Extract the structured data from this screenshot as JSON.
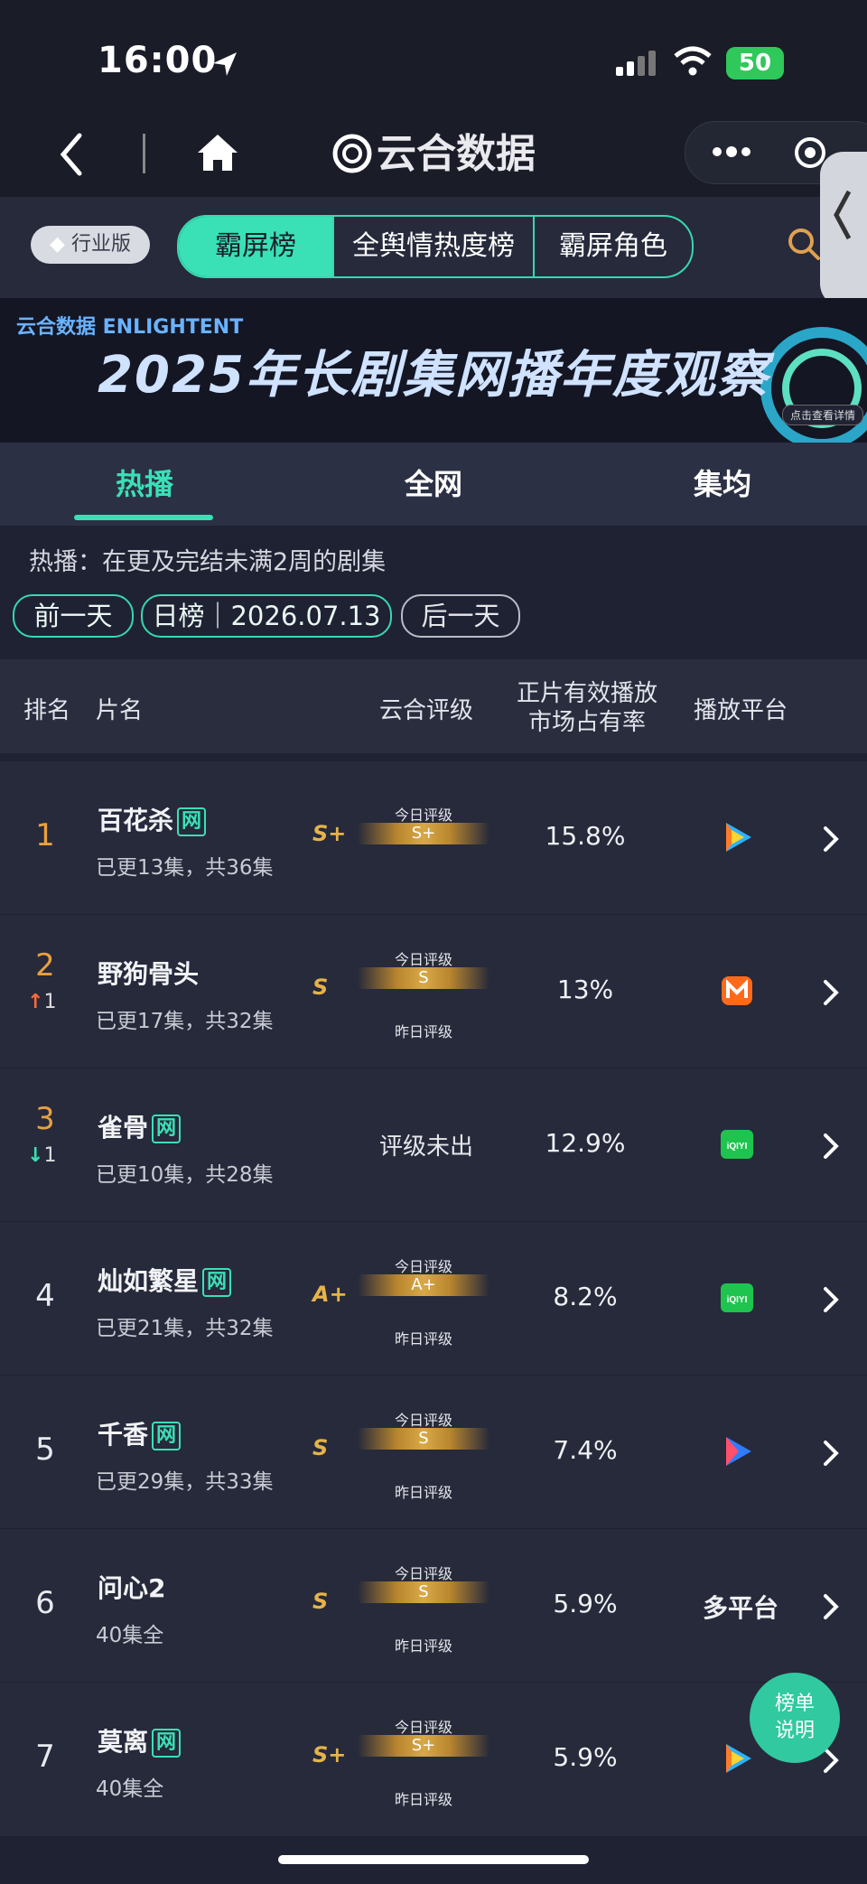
{
  "status": {
    "time": "16:00",
    "battery": "50"
  },
  "nav": {
    "title": "云合数据"
  },
  "tier_badge": "行业版",
  "segments": [
    "霸屏榜",
    "全舆情热度榜",
    "霸屏角色"
  ],
  "banner": {
    "logo": "云合数据 ENLIGHTENT",
    "title": "2025年长剧集网播年度观察",
    "hint": "点击查看详情"
  },
  "tabs": [
    "热播",
    "全网",
    "集均"
  ],
  "description": "热播：在更及完结未满2周的剧集",
  "date_controls": {
    "prev": "前一天",
    "daily": "日榜｜2026.07.13",
    "next": "后一天"
  },
  "table_header": {
    "rank": "排名",
    "name": "片名",
    "rating": "云合评级",
    "share": "正片有效播放\n市场占有率",
    "platform": "播放平台"
  },
  "rows": [
    {
      "rank": "1",
      "change": "",
      "title": "百花杀",
      "badge": "网",
      "episodes": "已更13集，共36集",
      "grade": "S+",
      "bar": "S+",
      "top": "今日评级",
      "bottom": "",
      "share": "15.8%",
      "platform": "tencent"
    },
    {
      "rank": "2",
      "change": "1",
      "title": "野狗骨头",
      "badge": "",
      "episodes": "已更17集，共32集",
      "grade": "S",
      "bar": "S",
      "top": "今日评级",
      "bottom": "昨日评级",
      "share": "13%",
      "platform": "mango"
    },
    {
      "rank": "3",
      "change": "1",
      "title": "雀骨",
      "badge": "网",
      "episodes": "已更10集，共28集",
      "grade": "",
      "bar": "",
      "top": "",
      "bottom": "",
      "rating_text": "评级未出",
      "share": "12.9%",
      "platform": "iqiyi"
    },
    {
      "rank": "4",
      "change": "",
      "title": "灿如繁星",
      "badge": "网",
      "episodes": "已更21集，共32集",
      "grade": "A+",
      "bar": "A+",
      "top": "今日评级",
      "bottom": "昨日评级",
      "share": "8.2%",
      "platform": "iqiyi"
    },
    {
      "rank": "5",
      "change": "",
      "title": "千香",
      "badge": "网",
      "episodes": "已更29集，共33集",
      "grade": "S",
      "bar": "S",
      "top": "今日评级",
      "bottom": "昨日评级",
      "share": "7.4%",
      "platform": "youku"
    },
    {
      "rank": "6",
      "change": "",
      "title": "问心2",
      "badge": "",
      "episodes": "40集全",
      "grade": "S",
      "bar": "S",
      "top": "今日评级",
      "bottom": "昨日评级",
      "share": "5.9%",
      "platform_text": "多平台"
    },
    {
      "rank": "7",
      "change": "",
      "title": "莫离",
      "badge": "网",
      "episodes": "40集全",
      "grade": "S+",
      "bar": "S+",
      "top": "今日评级",
      "bottom": "昨日评级",
      "share": "5.9%",
      "platform": "tencent"
    }
  ],
  "fab": {
    "line1": "榜单",
    "line2": "说明"
  },
  "colors": {
    "accent": "#3ae0b6",
    "rank_gold": "#e9a040",
    "background": "#1f2233"
  }
}
